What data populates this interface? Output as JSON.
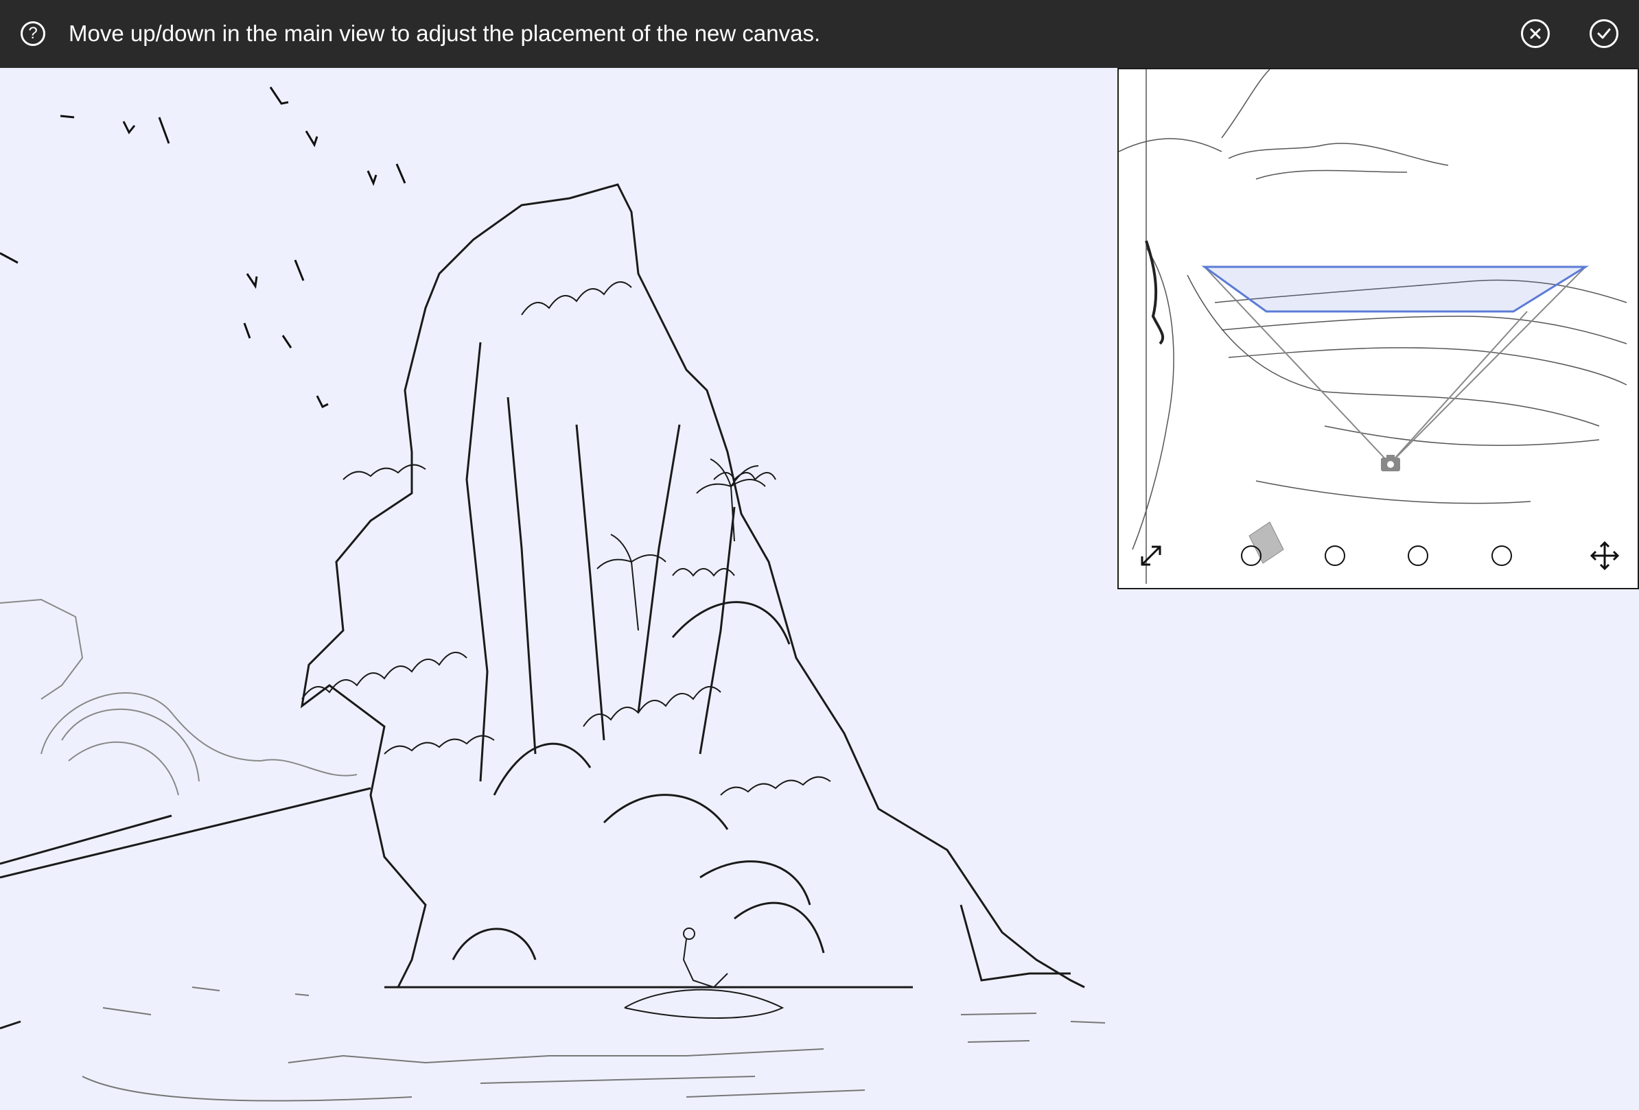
{
  "topbar": {
    "help_icon": "question-circle-icon",
    "hint_text": "Move up/down in the main view to adjust the placement of the new canvas.",
    "cancel_icon": "close-circle-icon",
    "confirm_icon": "check-circle-icon"
  },
  "preview": {
    "toolbar": {
      "left_icon": "diagonal-resize-icon",
      "options": [
        "option-1",
        "option-2",
        "option-3",
        "option-4"
      ],
      "right_icon": "move-arrows-icon"
    },
    "camera_icon": "camera-icon",
    "selection_color": "#5b7bd6"
  },
  "canvas": {
    "background": "#eef1fd"
  }
}
